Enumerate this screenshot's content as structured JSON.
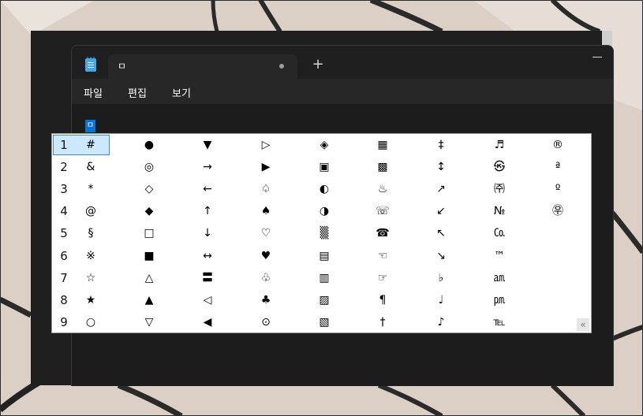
{
  "notepad": {
    "tab_title": "ㅁ",
    "new_tab": "+",
    "menu": [
      "파일",
      "편집",
      "보기"
    ],
    "editor_text": "ㅁ"
  },
  "candidates": {
    "rows": [
      {
        "num": "1",
        "symbols": [
          "#",
          "●",
          "▼",
          "▷",
          "◈",
          "▦",
          "‡",
          "♬",
          "®"
        ]
      },
      {
        "num": "2",
        "symbols": [
          "&",
          "◎",
          "→",
          "▶",
          "▣",
          "▩",
          "↕",
          "㉿",
          "ª"
        ]
      },
      {
        "num": "3",
        "symbols": [
          "*",
          "◇",
          "←",
          "♤",
          "◐",
          "♨",
          "↗",
          "㈜",
          "º"
        ]
      },
      {
        "num": "4",
        "symbols": [
          "@",
          "◆",
          "↑",
          "♠",
          "◑",
          "☏",
          "↙",
          "№",
          "㉾"
        ]
      },
      {
        "num": "5",
        "symbols": [
          "§",
          "□",
          "↓",
          "♡",
          "▒",
          "☎",
          "↖",
          "㏇",
          ""
        ]
      },
      {
        "num": "6",
        "symbols": [
          "※",
          "■",
          "↔",
          "♥",
          "▤",
          "☜",
          "↘",
          "™",
          ""
        ]
      },
      {
        "num": "7",
        "symbols": [
          "☆",
          "△",
          "〓",
          "♧",
          "▥",
          "☞",
          "♭",
          "㏂",
          ""
        ]
      },
      {
        "num": "8",
        "symbols": [
          "★",
          "▲",
          "◁",
          "♣",
          "▨",
          "¶",
          "♩",
          "㏘",
          ""
        ]
      },
      {
        "num": "9",
        "symbols": [
          "○",
          "▽",
          "◀",
          "⊙",
          "▧",
          "†",
          "♪",
          "℡",
          ""
        ]
      }
    ],
    "selected_index": 0,
    "collapse_label": "«"
  }
}
